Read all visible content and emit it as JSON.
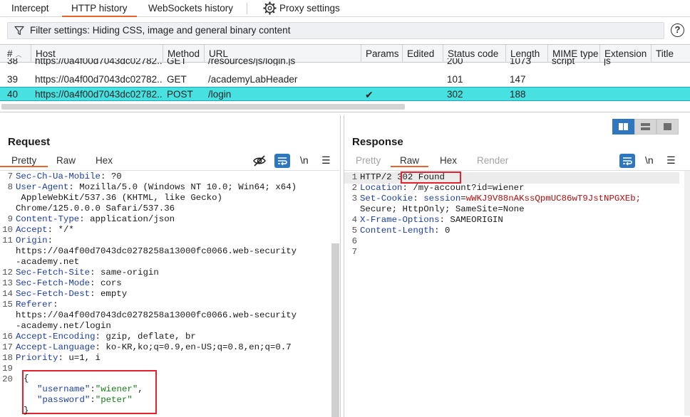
{
  "top_tabs": {
    "intercept": "Intercept",
    "http_history": "HTTP history",
    "websockets_history": "WebSockets history",
    "proxy_settings": "Proxy settings"
  },
  "filter": {
    "text": "Filter settings: Hiding CSS, image and general binary content",
    "help": "?"
  },
  "table": {
    "columns": [
      "#",
      "Host",
      "Method",
      "URL",
      "Params",
      "Edited",
      "Status code",
      "Length",
      "MIME type",
      "Extension",
      "Title"
    ],
    "rows": [
      {
        "num": "38",
        "host": "https://0a4f00d7043dc02782...",
        "method": "GET",
        "url": "/resources/js/login.js",
        "params": "",
        "status": "200",
        "length": "1073",
        "mime": "script",
        "ext": "js"
      },
      {
        "num": "39",
        "host": "https://0a4f00d7043dc02782...",
        "method": "GET",
        "url": "/academyLabHeader",
        "params": "",
        "status": "101",
        "length": "147",
        "mime": "",
        "ext": ""
      },
      {
        "num": "40",
        "host": "https://0a4f00d7043dc02782...",
        "method": "POST",
        "url": "/login",
        "params": "✔",
        "status": "302",
        "length": "188",
        "mime": "",
        "ext": ""
      }
    ]
  },
  "request": {
    "title": "Request",
    "tabs": [
      "Pretty",
      "Raw",
      "Hex"
    ],
    "newline_btn": "\\n",
    "lines": [
      {
        "n": "7",
        "key": "Sec-Ch-Ua-Mobile",
        "val": " ?0"
      },
      {
        "n": "8",
        "key": "User-Agent",
        "val": " Mozilla/5.0 (Windows NT 10.0; Win64; x64)"
      },
      {
        "n": "",
        "key": "",
        "val": " AppleWebKit/537.36 (KHTML, like Gecko)"
      },
      {
        "n": "",
        "key": "",
        "val": "Chrome/125.0.0.0 Safari/537.36"
      },
      {
        "n": "9",
        "key": "Content-Type",
        "val": " application/json"
      },
      {
        "n": "10",
        "key": "Accept",
        "val": " */*"
      },
      {
        "n": "11",
        "key": "Origin",
        "val": ""
      },
      {
        "n": "",
        "key": "",
        "val": "https://0a4f00d7043dc0278258a13000fc0066.web-security"
      },
      {
        "n": "",
        "key": "",
        "val": "-academy.net"
      },
      {
        "n": "12",
        "key": "Sec-Fetch-Site",
        "val": " same-origin"
      },
      {
        "n": "13",
        "key": "Sec-Fetch-Mode",
        "val": " cors"
      },
      {
        "n": "14",
        "key": "Sec-Fetch-Dest",
        "val": " empty"
      },
      {
        "n": "15",
        "key": "Referer",
        "val": ""
      },
      {
        "n": "",
        "key": "",
        "val": "https://0a4f00d7043dc0278258a13000fc0066.web-security"
      },
      {
        "n": "",
        "key": "",
        "val": "-academy.net/login"
      },
      {
        "n": "16",
        "key": "Accept-Encoding",
        "val": " gzip, deflate, br"
      },
      {
        "n": "17",
        "key": "Accept-Language",
        "val": " ko-KR,ko;q=0.9,en-US;q=0.8,en;q=0.7"
      },
      {
        "n": "18",
        "key": "Priority",
        "val": " u=1, i"
      },
      {
        "n": "19",
        "key": "",
        "val": ""
      }
    ],
    "body_line_no": "20",
    "body": {
      "open": "{",
      "username_key": "\"username\"",
      "username_val": "\"wiener\"",
      "password_key": "\"password\"",
      "password_val": "\"peter\"",
      "close": "}"
    }
  },
  "response": {
    "title": "Response",
    "tabs": [
      "Pretty",
      "Raw",
      "Hex",
      "Render"
    ],
    "newline_btn": "\\n",
    "status_proto": "HTTP/2",
    "status_text": "302 Found",
    "lines": [
      {
        "n": "2",
        "key": "Location",
        "val": " /my-account?id=wiener"
      },
      {
        "n": "3",
        "key": "Set-Cookie",
        "val": ""
      },
      {
        "n": "",
        "key": "",
        "val": "Secure; HttpOnly; SameSite=None"
      },
      {
        "n": "4",
        "key": "X-Frame-Options",
        "val": " SAMEORIGIN"
      },
      {
        "n": "5",
        "key": "Content-Length",
        "val": " 0"
      },
      {
        "n": "6",
        "key": "",
        "val": ""
      },
      {
        "n": "7",
        "key": "",
        "val": ""
      }
    ],
    "cookie_name": "session",
    "cookie_value": "wWKJ9V88nAKssQpmUC86wT9JstNPGXEb;"
  },
  "colors": {
    "accent": "#e8642c",
    "selected_row": "#48e1e1",
    "highlight_box": "#e4222e",
    "button_blue": "#2e77bf"
  }
}
